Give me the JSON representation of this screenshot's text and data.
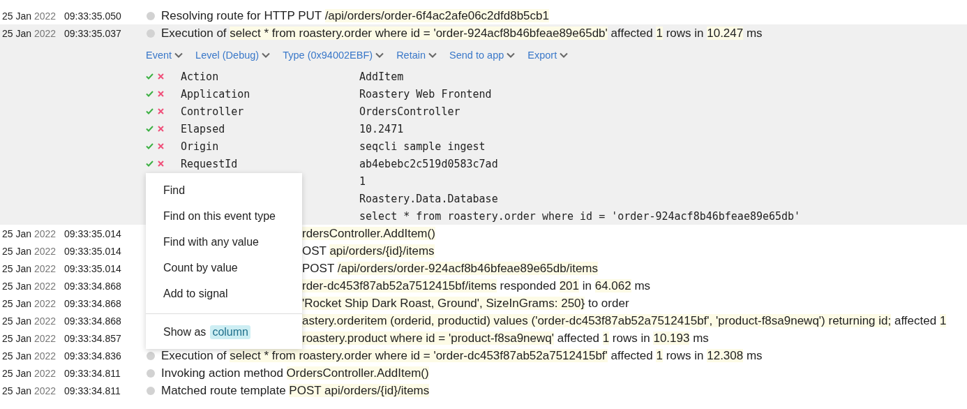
{
  "events": [
    {
      "date": "25 Jan",
      "year": "2022",
      "time": "09:33:35.050",
      "message": [
        {
          "text": "Resolving route for HTTP PUT ",
          "kind": "plain"
        },
        {
          "text": "/api/orders/order-6f4ac2afe06c2dfd8b5cb1",
          "kind": "value"
        }
      ]
    },
    {
      "date": "25 Jan",
      "year": "2022",
      "time": "09:33:35.037",
      "expanded": true,
      "message": [
        {
          "text": "Execution of ",
          "kind": "plain"
        },
        {
          "text": "select * from roastery.order where id = 'order-924acf8b46bfeae89e65db'",
          "kind": "value"
        },
        {
          "text": " affected ",
          "kind": "plain"
        },
        {
          "text": "1",
          "kind": "value"
        },
        {
          "text": " rows in ",
          "kind": "plain"
        },
        {
          "text": "10.247",
          "kind": "value"
        },
        {
          "text": " ms",
          "kind": "plain"
        }
      ],
      "detail": {
        "actions": [
          "Event",
          "Level (Debug)",
          "Type (0x94002EBF)",
          "Retain",
          "Send to app",
          "Export"
        ],
        "properties": [
          {
            "name": "Action",
            "value": "AddItem"
          },
          {
            "name": "Application",
            "value": "Roastery Web Frontend"
          },
          {
            "name": "Controller",
            "value": "OrdersController"
          },
          {
            "name": "Elapsed",
            "value": "10.2471"
          },
          {
            "name": "Origin",
            "value": "seqcli sample ingest"
          },
          {
            "name": "RequestId",
            "value": "ab4ebebc2c519d0583c7ad"
          },
          {
            "value": "1"
          },
          {
            "value": "Roastery.Data.Database"
          },
          {
            "value": "select * from roastery.order where id = 'order-924acf8b46bfeae89e65db'"
          }
        ]
      }
    },
    {
      "date": "25 Jan",
      "year": "2022",
      "time": "09:33:35.014",
      "covered": true,
      "message": [
        {
          "text": "rdersController.AddItem()",
          "kind": "value"
        }
      ]
    },
    {
      "date": "25 Jan",
      "year": "2022",
      "time": "09:33:35.014",
      "covered": true,
      "message": [
        {
          "text": "OST ",
          "kind": "plain"
        },
        {
          "text": "api/orders/{id}/items",
          "kind": "value"
        }
      ]
    },
    {
      "date": "25 Jan",
      "year": "2022",
      "time": "09:33:35.014",
      "covered": true,
      "message": [
        {
          "text": "POST ",
          "kind": "plain"
        },
        {
          "text": "/api/orders/order-924acf8b46bfeae89e65db/items",
          "kind": "value"
        }
      ]
    },
    {
      "date": "25 Jan",
      "year": "2022",
      "time": "09:33:34.868",
      "covered": true,
      "message": [
        {
          "text": "rder-dc453f87ab52a7512415bf/items",
          "kind": "value"
        },
        {
          "text": " responded ",
          "kind": "plain"
        },
        {
          "text": "201",
          "kind": "value"
        },
        {
          "text": " in ",
          "kind": "plain"
        },
        {
          "text": "64.062",
          "kind": "value"
        },
        {
          "text": " ms",
          "kind": "plain"
        }
      ]
    },
    {
      "date": "25 Jan",
      "year": "2022",
      "time": "09:33:34.868",
      "covered": true,
      "message": [
        {
          "text": "'Rocket Ship Dark Roast, Ground', SizeInGrams: 250}",
          "kind": "value"
        },
        {
          "text": " to order",
          "kind": "plain"
        }
      ]
    },
    {
      "date": "25 Jan",
      "year": "2022",
      "time": "09:33:34.868",
      "covered": true,
      "message": [
        {
          "text": "astery.orderitem (orderid, productid) values ('order-dc453f87ab52a7512415bf', 'product-f8sa9newq') returning id;",
          "kind": "value"
        },
        {
          "text": " affected ",
          "kind": "plain"
        },
        {
          "text": "1",
          "kind": "value"
        }
      ]
    },
    {
      "date": "25 Jan",
      "year": "2022",
      "time": "09:33:34.857",
      "covered": true,
      "message": [
        {
          "text": "roastery.product where id = 'product-f8sa9newq'",
          "kind": "value"
        },
        {
          "text": " affected ",
          "kind": "plain"
        },
        {
          "text": "1",
          "kind": "value"
        },
        {
          "text": " rows in ",
          "kind": "plain"
        },
        {
          "text": "10.193",
          "kind": "value"
        },
        {
          "text": " ms",
          "kind": "plain"
        }
      ]
    },
    {
      "date": "25 Jan",
      "year": "2022",
      "time": "09:33:34.836",
      "message": [
        {
          "text": "Execution of ",
          "kind": "plain"
        },
        {
          "text": "select * from roastery.order where id = 'order-dc453f87ab52a7512415bf'",
          "kind": "value"
        },
        {
          "text": " affected ",
          "kind": "plain"
        },
        {
          "text": "1",
          "kind": "value"
        },
        {
          "text": " rows in ",
          "kind": "plain"
        },
        {
          "text": "12.308",
          "kind": "value"
        },
        {
          "text": " ms",
          "kind": "plain"
        }
      ]
    },
    {
      "date": "25 Jan",
      "year": "2022",
      "time": "09:33:34.811",
      "message": [
        {
          "text": "Invoking action method ",
          "kind": "plain"
        },
        {
          "text": "OrdersController.AddItem()",
          "kind": "value"
        }
      ]
    },
    {
      "date": "25 Jan",
      "year": "2022",
      "time": "09:33:34.811",
      "message": [
        {
          "text": "Matched route template ",
          "kind": "plain"
        },
        {
          "text": "POST api/orders/{id}/items",
          "kind": "value"
        }
      ]
    }
  ],
  "context_menu": {
    "items": [
      {
        "label": "Find"
      },
      {
        "label": "Find on this event type"
      },
      {
        "label": "Find with any value"
      },
      {
        "label": "Count by value"
      },
      {
        "label": "Add to signal"
      }
    ],
    "footer": {
      "label": "Show as",
      "option": "column"
    }
  }
}
